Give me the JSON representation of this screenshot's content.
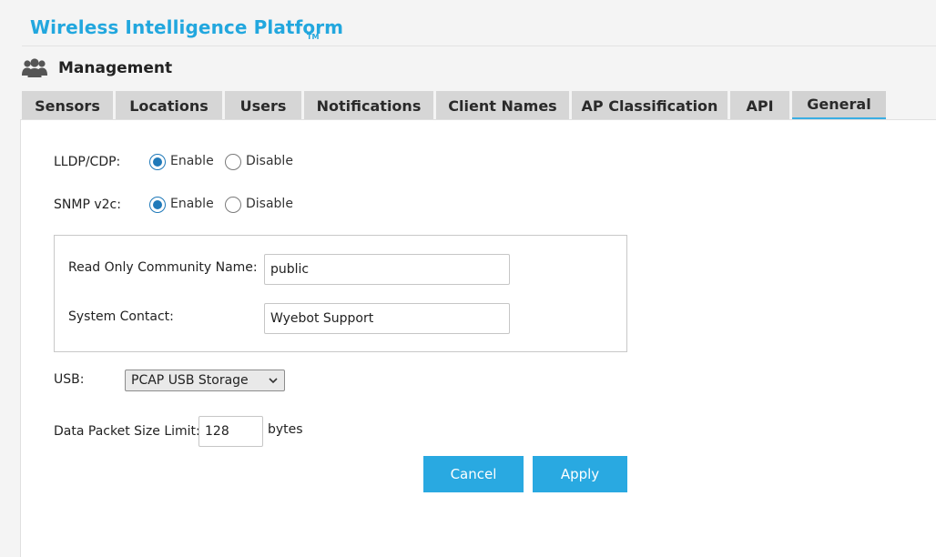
{
  "header": {
    "brand": "Wireless Intelligence Platform",
    "trademark": "TM",
    "section_title": "Management"
  },
  "tabs": [
    {
      "label": "Sensors",
      "active": false
    },
    {
      "label": "Locations",
      "active": false
    },
    {
      "label": "Users",
      "active": false
    },
    {
      "label": "Notifications",
      "active": false
    },
    {
      "label": "Client Names",
      "active": false
    },
    {
      "label": "AP Classification",
      "active": false
    },
    {
      "label": "API",
      "active": false
    },
    {
      "label": "General",
      "active": true
    }
  ],
  "form": {
    "lldp": {
      "label": "LLDP/CDP:",
      "enable": "Enable",
      "disable": "Disable",
      "selected": "Enable"
    },
    "snmp": {
      "label": "SNMP v2c:",
      "enable": "Enable",
      "disable": "Disable",
      "selected": "Enable"
    },
    "community": {
      "label": "Read Only Community Name:",
      "value": "public"
    },
    "contact": {
      "label": "System Contact:",
      "value": "Wyebot Support"
    },
    "usb": {
      "label": "USB:",
      "selected": "PCAP USB Storage"
    },
    "packet_size": {
      "label": "Data Packet Size Limit:",
      "value": "128",
      "unit": "bytes"
    }
  },
  "buttons": {
    "cancel": "Cancel",
    "apply": "Apply"
  },
  "colors": {
    "brand": "#22a7de",
    "button": "#29a9e1",
    "tab_underline": "#3aaee3",
    "radio": "#1f79b9"
  },
  "icons": {
    "section": "users-group-icon",
    "dropdown": "chevron-down-icon"
  }
}
